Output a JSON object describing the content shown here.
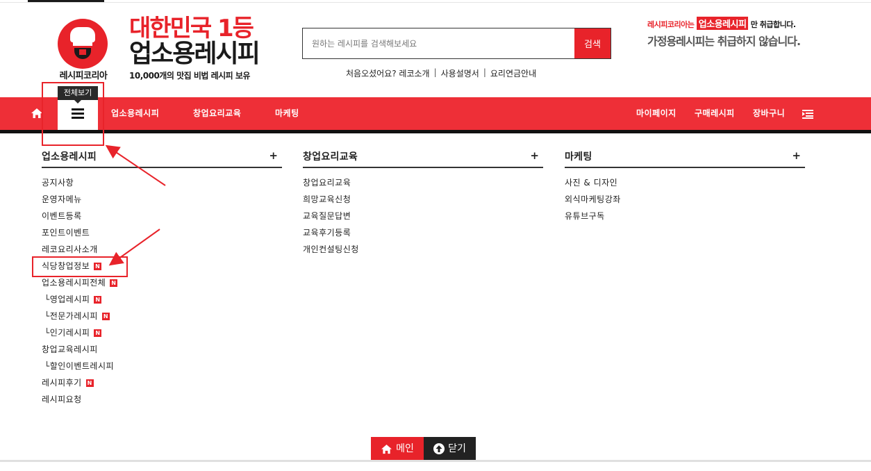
{
  "header": {
    "logo_name": "레시피코리아",
    "brand_line1": "대한민국 1등",
    "brand_line2": "업소용레시피",
    "brand_sub": "10,000개의 맛집 비법 레시피 보유",
    "promo_prefix": "레시피코리아는",
    "promo_badge": "업소용레시피",
    "promo_suffix": "만 취급합니다.",
    "promo_line2": "가정용레시피는 취급하지 않습니다."
  },
  "search": {
    "placeholder": "원하는 레시피를 검색해보세요",
    "button": "검색"
  },
  "sub_links": [
    "처음오셨어요? 레코소개",
    "사용설명서",
    "요리연금안내"
  ],
  "nav": {
    "tooltip": "전체보기",
    "left_items": [
      "업소용레시피",
      "창업요리교육",
      "마케팅"
    ],
    "right_items": [
      "마이페이지",
      "구매레시피",
      "장바구니"
    ]
  },
  "columns": [
    {
      "title": "업소용레시피",
      "plus": "+",
      "items": [
        {
          "label": "공지사항",
          "new": false,
          "indent": false
        },
        {
          "label": "운영자메뉴",
          "new": false,
          "indent": false
        },
        {
          "label": "이벤트등록",
          "new": false,
          "indent": false
        },
        {
          "label": "포인트이벤트",
          "new": false,
          "indent": false
        },
        {
          "label": "레코요리사소개",
          "new": false,
          "indent": false
        },
        {
          "label": "식당창업정보",
          "new": true,
          "indent": false
        },
        {
          "label": "업소용레시피전체",
          "new": true,
          "indent": false
        },
        {
          "label": "└영업레시피",
          "new": true,
          "indent": true
        },
        {
          "label": "└전문가레시피",
          "new": true,
          "indent": true
        },
        {
          "label": "└인기레시피",
          "new": true,
          "indent": true
        },
        {
          "label": "창업교육레시피",
          "new": false,
          "indent": false
        },
        {
          "label": "└할인이벤트레시피",
          "new": false,
          "indent": true
        },
        {
          "label": "레시피후기",
          "new": true,
          "indent": false
        },
        {
          "label": "레시피요청",
          "new": false,
          "indent": false
        }
      ]
    },
    {
      "title": "창업요리교육",
      "plus": "+",
      "items": [
        {
          "label": "창업요리교육",
          "new": false,
          "indent": false
        },
        {
          "label": "희망교육신청",
          "new": false,
          "indent": false
        },
        {
          "label": "교육질문답변",
          "new": false,
          "indent": false
        },
        {
          "label": "교육후기등록",
          "new": false,
          "indent": false
        },
        {
          "label": "개인컨설팅신청",
          "new": false,
          "indent": false
        }
      ]
    },
    {
      "title": "마케팅",
      "plus": "+",
      "items": [
        {
          "label": "사진 & 디자인",
          "new": false,
          "indent": false
        },
        {
          "label": "외식마케팅강좌",
          "new": false,
          "indent": false
        },
        {
          "label": "유튜브구독",
          "new": false,
          "indent": false
        }
      ]
    }
  ],
  "badge_text": "N",
  "footer": {
    "main_button": "메인",
    "close_button": "닫기"
  },
  "colors": {
    "accent": "#ee2f37",
    "dark": "#222222",
    "annotation": "#e8232a"
  }
}
